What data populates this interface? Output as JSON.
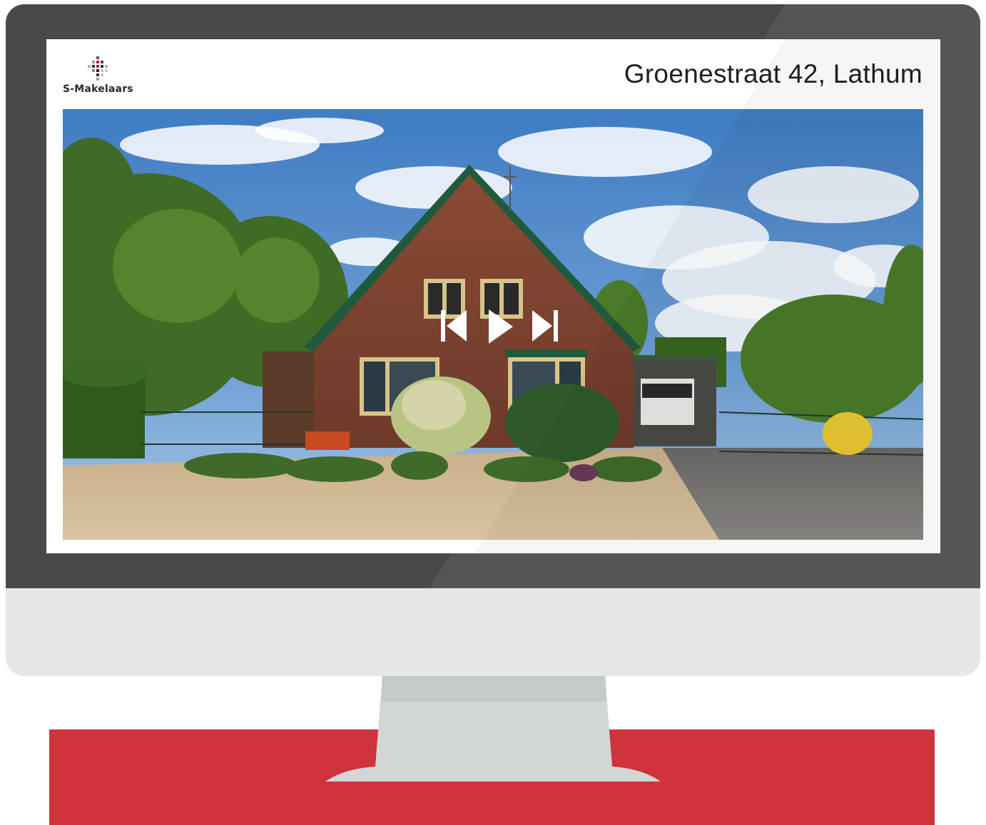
{
  "logo": {
    "name": "S-Makelaars"
  },
  "listing": {
    "address": "Groenestraat 42, Lathum"
  },
  "slideshow": {
    "controls": [
      {
        "icon": "skip-previous-icon"
      },
      {
        "icon": "play-icon"
      },
      {
        "icon": "skip-next-icon"
      }
    ]
  },
  "colors": {
    "bezel": "#4a4948",
    "chin": "#e6e7e9",
    "stand": "#d3d6d7",
    "band": "#cf333c",
    "logo_red": "#c8102e"
  }
}
